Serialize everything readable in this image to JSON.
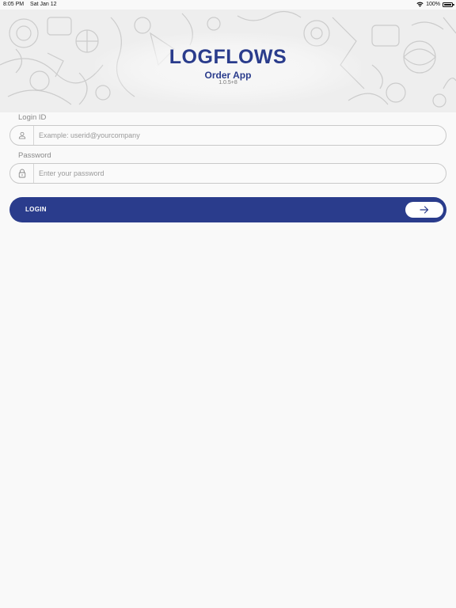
{
  "status_bar": {
    "time": "8:05 PM",
    "date": "Sat Jan 12",
    "battery_percent": "100%",
    "battery_level": 1.0,
    "wifi_icon": "wifi-icon",
    "battery_icon": "battery-icon"
  },
  "header": {
    "title": "LOGFLOWS",
    "subtitle": "Order App",
    "version": "1.0.5+8"
  },
  "form": {
    "login_id": {
      "label": "Login ID",
      "placeholder": "Example: userid@yourcompany",
      "value": "",
      "icon": "user-icon"
    },
    "password": {
      "label": "Password",
      "placeholder": "Enter your password",
      "value": "",
      "icon": "lock-icon"
    },
    "login_button": {
      "label": "LOGIN",
      "icon": "arrow-right-icon"
    }
  },
  "colors": {
    "brand": "#2a3c8c",
    "background": "#f9f9f9",
    "input_border": "#c9c9c9",
    "placeholder": "#9a9a9a"
  }
}
